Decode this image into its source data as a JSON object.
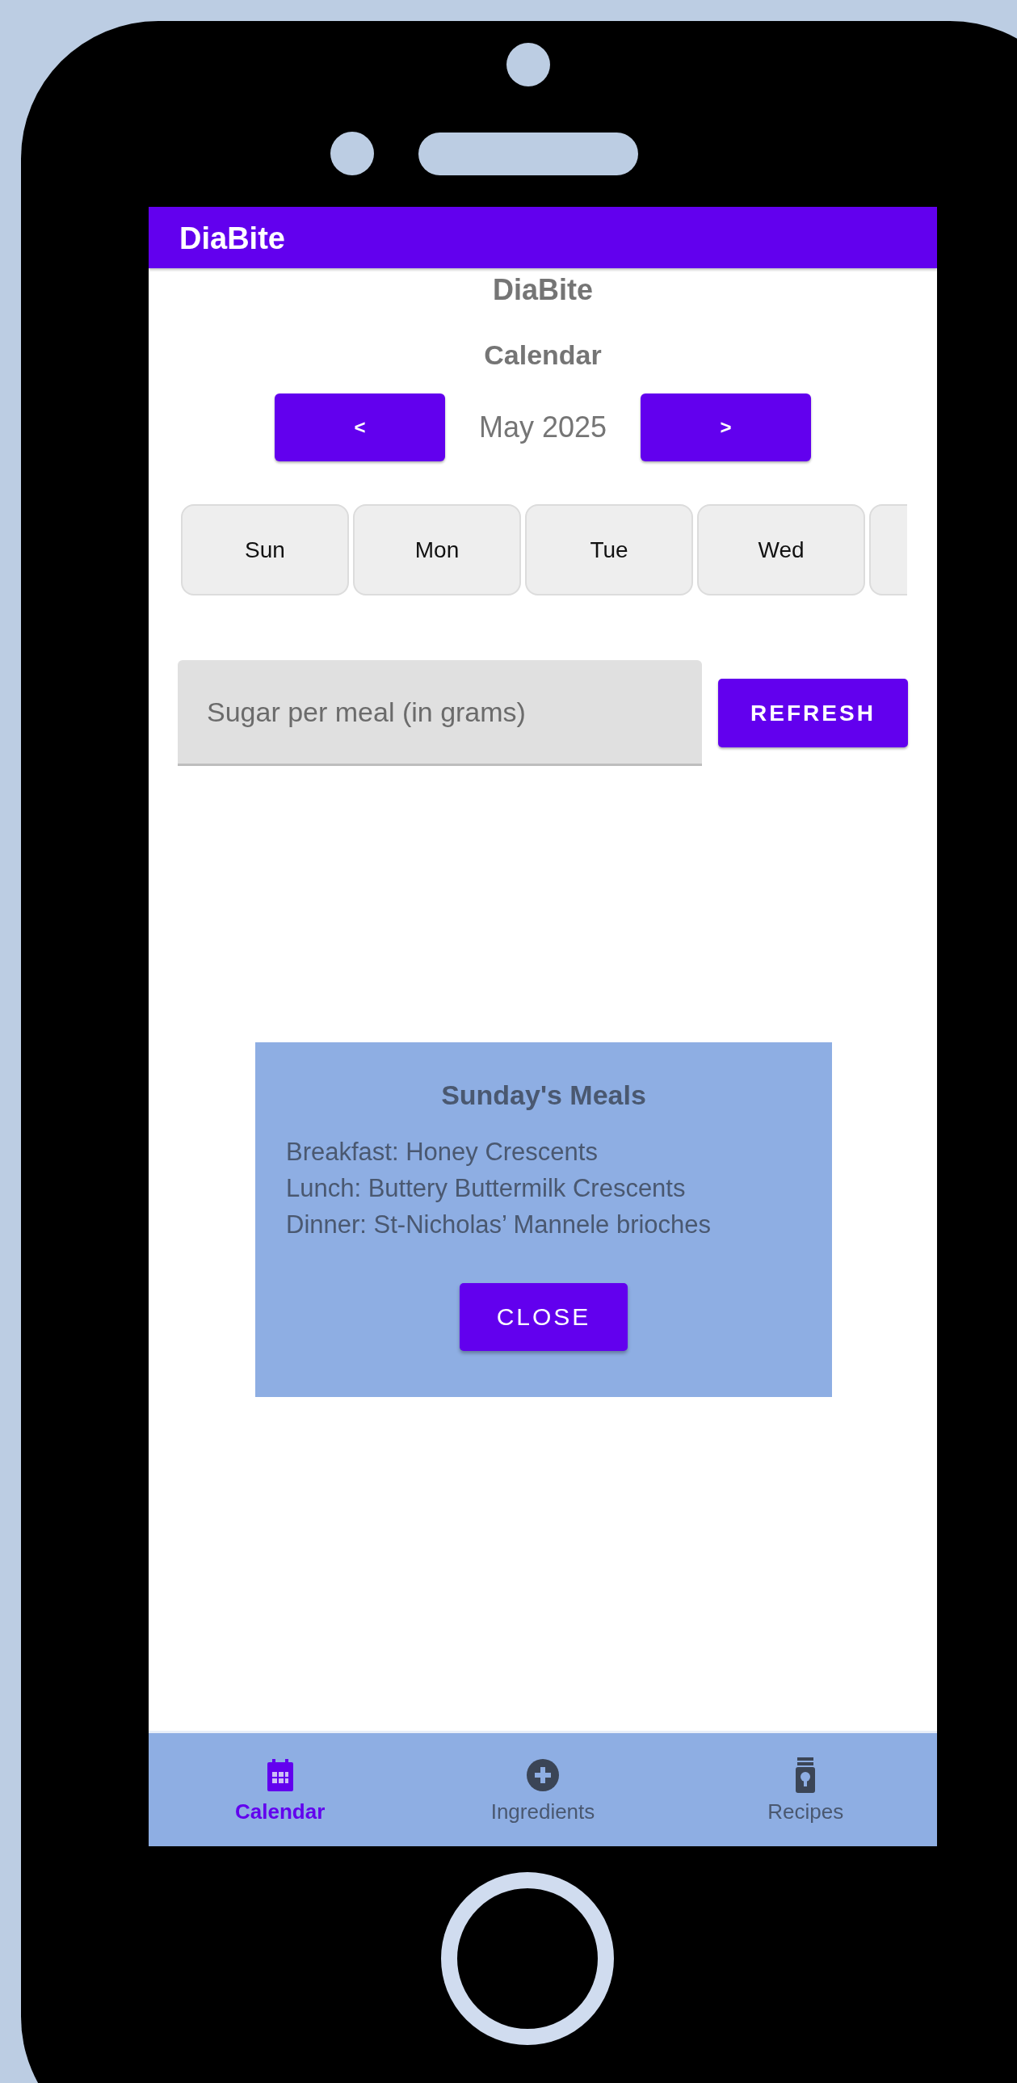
{
  "app_bar": {
    "title": "DiaBite"
  },
  "heading": "DiaBite",
  "subheading": "Calendar",
  "month_nav": {
    "prev": "<",
    "month": "May 2025",
    "next": ">"
  },
  "days": [
    {
      "label": "Sun"
    },
    {
      "label": "Mon"
    },
    {
      "label": "Tue"
    },
    {
      "label": "Wed"
    }
  ],
  "sugar_field": {
    "placeholder": "Sugar per meal (in grams)"
  },
  "refresh_button": "REFRESH",
  "dialog": {
    "title": "Sunday's Meals",
    "lines": [
      "Breakfast: Honey Crescents",
      "Lunch: Buttery Buttermilk Crescents",
      "Dinner: St-Nicholas’ Mannele brioches"
    ],
    "close_button": "CLOSE"
  },
  "bottom_nav": [
    {
      "label": "Calendar",
      "selected": true
    },
    {
      "label": "Ingredients",
      "selected": false
    },
    {
      "label": "Recipes",
      "selected": false
    }
  ]
}
